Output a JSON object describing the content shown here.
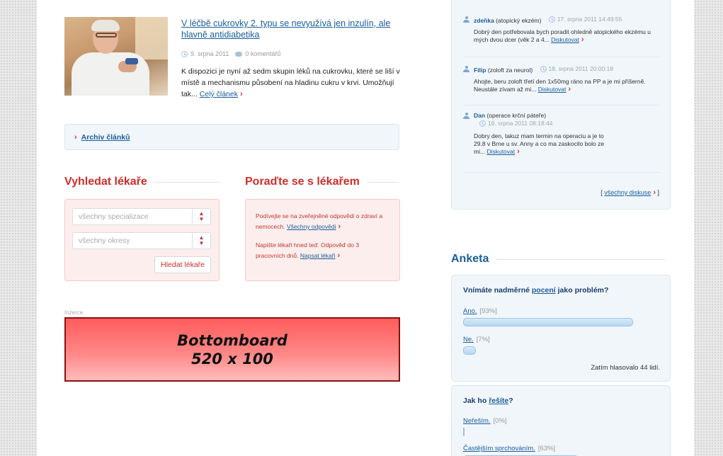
{
  "article": {
    "title": "V léčbě cukrovky 2. typu se nevyužívá jen inzulín, ale hlavně antidiabetika",
    "date": "9. srpna 2011",
    "comments": "0 komentářů",
    "text": "K dispozici je nyní až sedm skupin léků na cukrovku, které se liší v místě a mechanismu působení na hladinu cukru v krvi. Umožňují tak...",
    "more_link": "Celý článek"
  },
  "archive": {
    "link": "Archiv článků"
  },
  "find_doctor": {
    "title": "Vyhledat lékaře",
    "specialization_placeholder": "všechny specializace",
    "district_placeholder": "všechny okresy",
    "button": "Hledat lékaře"
  },
  "advice": {
    "title": "Poraďte se s lékařem",
    "text1": "Podívejte se na zveřejněné odpovědi o zdraví a nemocech.",
    "link1": "Všechny odpovědi",
    "text2": "Napište lékaři hned teď. Odpověď do 3 pracovních dnů.",
    "link2": "Napsat lékaři"
  },
  "ad": {
    "label": "Inzerce",
    "line1": "Bottomboard",
    "line2": "520 x 100"
  },
  "discussions": {
    "items": [
      {
        "name": "zdeňka",
        "topic": "(atopický ekzém)",
        "date": "17. srpna 2011 14:49:55",
        "text": "Dobrý den potřebovala bych poradit ohledně atopického ekzému u mých dvou dcer (věk 2 a 4...",
        "link": "Diskutovat"
      },
      {
        "name": "Filip",
        "topic": "(zoloft za neurol)",
        "date": "18. srpna 2011 20:00:18",
        "text": "Ahojte, beru zoloft třetí den 1x50mg ráno na PP a je mi příšerně. Neustále zívam až mi...",
        "link": "Diskutovat"
      },
      {
        "name": "Dan",
        "topic": "(operace krční páteře)",
        "date": "16. srpna 2011 08:18:44",
        "text": "Dobry den, takuz mam termin na operaciu a je to 29.8 v Brne u sv. Anny a co ma zaskocilo bolo ze mi...",
        "link": "Diskutovat"
      }
    ],
    "all_link": "všechny diskuse"
  },
  "poll": {
    "title": "Anketa",
    "q1": {
      "prefix": "Vnímáte nadměrné",
      "link": "pocení",
      "suffix": "jako problém?",
      "options": [
        {
          "label": "Ano.",
          "pct": "[93%]",
          "value": 93
        },
        {
          "label": "Ne.",
          "pct": "[7%]",
          "value": 7
        }
      ],
      "total": "Zatím hlasovalo 44 lidí."
    },
    "q2": {
      "prefix": "Jak ho",
      "link": "řešíte",
      "suffix": "?",
      "options": [
        {
          "label": "Neřeším.",
          "pct": "[0%]",
          "value": 0
        },
        {
          "label": "Častějším sprchováním.",
          "pct": "[63%]",
          "value": 63
        }
      ]
    }
  }
}
